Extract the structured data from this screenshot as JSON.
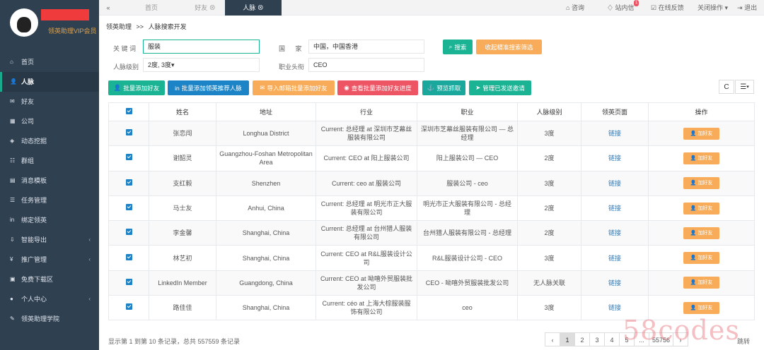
{
  "sidebar": {
    "vip_label": "领英助理VIP会员",
    "items": [
      {
        "icon": "⌂",
        "label": "首页"
      },
      {
        "icon": "👤",
        "label": "人脉"
      },
      {
        "icon": "✉",
        "label": "好友"
      },
      {
        "icon": "▦",
        "label": "公司"
      },
      {
        "icon": "◈",
        "label": "动态挖掘"
      },
      {
        "icon": "☷",
        "label": "群组"
      },
      {
        "icon": "▤",
        "label": "消息模板"
      },
      {
        "icon": "☰",
        "label": "任务管理"
      },
      {
        "icon": "in",
        "label": "绑定领英"
      },
      {
        "icon": "⇩",
        "label": "智能导出"
      },
      {
        "icon": "¥",
        "label": "推广管理"
      },
      {
        "icon": "▣",
        "label": "免费下载区"
      },
      {
        "icon": "●",
        "label": "个人中心"
      },
      {
        "icon": "✎",
        "label": "领英助理学院"
      }
    ]
  },
  "topbar": {
    "back_icon": "«",
    "tabs": [
      {
        "label": "首页"
      },
      {
        "label": "好友"
      },
      {
        "label": "人脉"
      }
    ],
    "right": {
      "consult": "咨询",
      "inbox": "站内信",
      "inbox_count": "1",
      "feedback": "在线反馈",
      "close_ops": "关闭操作",
      "logout": "退出"
    }
  },
  "breadcrumb": {
    "root": "领英助理",
    "sep": ">>",
    "current": "人脉搜索开发"
  },
  "search": {
    "keyword_label": "关 键 词",
    "keyword_value": "服装",
    "country_label": "国 家",
    "country_value": "中国，中国香港",
    "level_label": "人脉级别",
    "level_value": "2度, 3度",
    "title_label": "职业头衔",
    "title_value": "CEO",
    "search_button": "搜索",
    "reset_button": "收起精准搜索筛选"
  },
  "actions": {
    "bulk_add_friends": "批量添加好友",
    "bulk_add_recommended": "批量添加领英推荐人脉",
    "import_email_add": "导入邮箱批量添加好友",
    "view_progress": "查看批量添加好友进度",
    "auto_grab": "预览抓取",
    "manage_invites": "管理已发送邀请",
    "refresh_icon": "C",
    "columns_icon": "☰"
  },
  "table": {
    "headers": [
      "姓名",
      "地址",
      "行业",
      "职业",
      "人脉级别",
      "领英页面",
      "操作"
    ],
    "rows": [
      {
        "name": "张恋闯",
        "address": "Longhua District",
        "industry": "Current: 总经理 at 深圳市芝幕丝服装有限公司",
        "job": "深圳市芝幕丝服装有限公司 — 总经理",
        "level": "3度",
        "page": "链接",
        "op": "加好友"
      },
      {
        "name": "谢韶灵",
        "address": "Guangzhou-Foshan Metropolitan Area",
        "industry": "Current: CEO at 阳上服装公司",
        "job": "阳上服装公司 — CEO",
        "level": "2度",
        "page": "链接",
        "op": "加好友"
      },
      {
        "name": "支红毅",
        "address": "Shenzhen",
        "industry": "Current: ceo at 服装公司",
        "job": "服装公司 - ceo",
        "level": "3度",
        "page": "链接",
        "op": "加好友"
      },
      {
        "name": "马士友",
        "address": "Anhui, China",
        "industry": "Current: 总经理 at 明光市正大服装有限公司",
        "job": "明光市正大服装有限公司 - 总经理",
        "level": "2度",
        "page": "链接",
        "op": "加好友"
      },
      {
        "name": "李金馨",
        "address": "Shanghai, China",
        "industry": "Current: 总经理 at 台州猎人服装有限公司",
        "job": "台州猎人服装有限公司 - 总经理",
        "level": "2度",
        "page": "链接",
        "op": "加好友"
      },
      {
        "name": "林艺初",
        "address": "Shanghai, China",
        "industry": "Current: CEO at R&L服装设计公司",
        "job": "R&L服装设计公司 - CEO",
        "level": "3度",
        "page": "链接",
        "op": "加好友"
      },
      {
        "name": "LinkedIn Member",
        "address": "Guangdong, China",
        "industry": "Current: CEO at 呦嘻外贸服装批发公司",
        "job": "CEO - 呦嘻外贸服装批发公司",
        "level": "无人脉关联",
        "page": "链接",
        "op": "加好友"
      },
      {
        "name": "路佳佳",
        "address": "Shanghai, China",
        "industry": "Current: céo at 上海大棕服装服饰有限公司",
        "job": "ceo",
        "level": "3度",
        "page": "链接",
        "op": "加好友"
      }
    ]
  },
  "footer": {
    "info": "显示第 1 到第 10 条记录，总共 557559 条记录",
    "pages": [
      "‹",
      "1",
      "2",
      "3",
      "4",
      "5",
      "...",
      "55756",
      "›"
    ],
    "goto": "跳转"
  },
  "watermark": "58codes",
  "colors": {
    "sidebar": "#2f4050",
    "primary": "#1ab394",
    "blue": "#1c84c6",
    "orange": "#f8ac59",
    "red": "#ed5565"
  }
}
